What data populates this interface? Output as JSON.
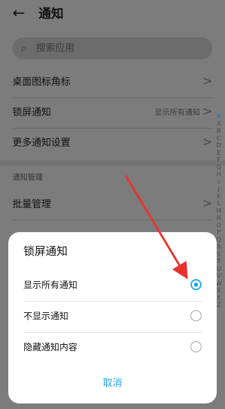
{
  "header": {
    "back_icon": "←",
    "title": "通知"
  },
  "search": {
    "icon": "search-icon",
    "placeholder": "搜索应用"
  },
  "rows": [
    {
      "label": "桌面图标角标",
      "value": ""
    },
    {
      "label": "锁屏通知",
      "value": "显示所有通知"
    },
    {
      "label": "更多通知设置",
      "value": ""
    }
  ],
  "section_title": "通知管理",
  "rows2": [
    {
      "label": "批量管理"
    }
  ],
  "chevron": ">",
  "index_letters": [
    "#",
    "A",
    "B",
    "C",
    "D",
    "E",
    "F",
    "G",
    "H",
    "I",
    "J",
    "K",
    "L",
    "M",
    "N",
    "O",
    "P",
    "Q",
    "R",
    "S",
    "T",
    "U",
    "V",
    "W",
    "X",
    "Y",
    "Z"
  ],
  "dialog": {
    "title": "锁屏通知",
    "options": [
      {
        "label": "显示所有通知",
        "selected": true
      },
      {
        "label": "不显示通知",
        "selected": false
      },
      {
        "label": "隐藏通知内容",
        "selected": false
      }
    ],
    "cancel": "取消"
  },
  "colors": {
    "accent": "#1aa7e8",
    "annotation_arrow": "#e8322e"
  }
}
